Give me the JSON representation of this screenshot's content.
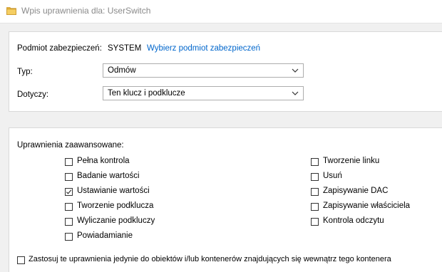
{
  "window": {
    "title": "Wpis uprawnienia dla: UserSwitch",
    "icon": "folder-icon"
  },
  "principal": {
    "label": "Podmiot zabezpieczeń:",
    "value": "SYSTEM",
    "link": "Wybierz podmiot zabezpieczeń"
  },
  "type": {
    "label": "Typ:",
    "value": "Odmów"
  },
  "applies_to": {
    "label": "Dotyczy:",
    "value": "Ten klucz i podklucze"
  },
  "advanced": {
    "heading": "Uprawnienia zaawansowane:",
    "left": [
      {
        "label": "Pełna kontrola",
        "checked": false
      },
      {
        "label": "Badanie wartości",
        "checked": false
      },
      {
        "label": "Ustawianie wartości",
        "checked": true
      },
      {
        "label": "Tworzenie podklucza",
        "checked": false
      },
      {
        "label": "Wyliczanie podkluczy",
        "checked": false
      },
      {
        "label": "Powiadamianie",
        "checked": false
      }
    ],
    "right": [
      {
        "label": "Tworzenie linku",
        "checked": false
      },
      {
        "label": "Usuń",
        "checked": false
      },
      {
        "label": "Zapisywanie DAC",
        "checked": false
      },
      {
        "label": "Zapisywanie właściciela",
        "checked": false
      },
      {
        "label": "Kontrola odczytu",
        "checked": false
      }
    ]
  },
  "apply_only": {
    "label": "Zastosuj te uprawnienia jedynie do obiektów i/lub kontenerów znajdujących się wewnątrz tego kontenera",
    "checked": false
  },
  "colors": {
    "link": "#0066cc",
    "folder": "#e8b53c",
    "window_bg": "#f0f0f0"
  }
}
